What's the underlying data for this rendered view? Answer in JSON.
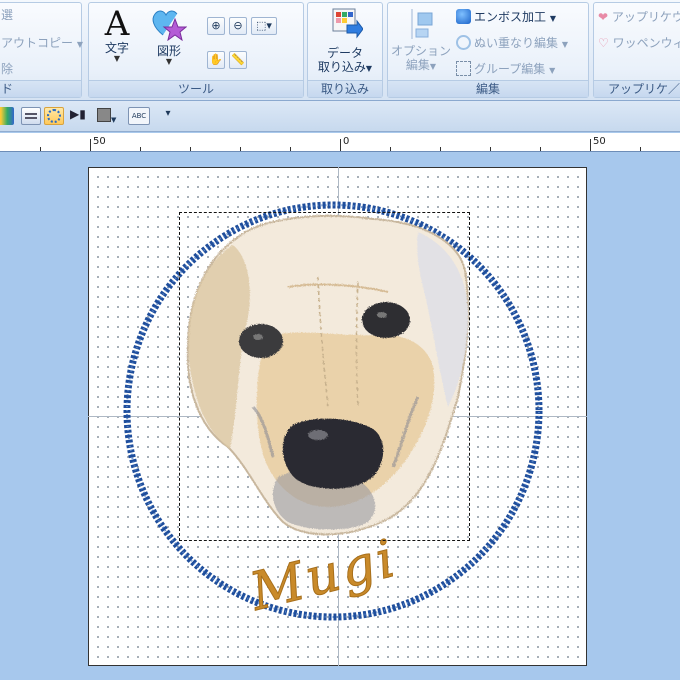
{
  "ribbon": {
    "group1": {
      "item1": "選",
      "item2": "アウトコピー",
      "item3": "除",
      "label": "ド"
    },
    "tools": {
      "text_label": "文字",
      "shape_label": "図形",
      "label": "ツール"
    },
    "import": {
      "data_label_line1": "データ",
      "data_label_line2": "取り込み",
      "label": "取り込み"
    },
    "edit": {
      "option_line1": "オプション",
      "option_line2": "編集",
      "emboss": "エンボス加工",
      "overlap": "ぬい重なり編集",
      "group_edit": "グループ編集",
      "label": "編集"
    },
    "applique": {
      "item1": "アップリケウ",
      "item2": "ワッペンウィ",
      "label": "アップリケ／ワ"
    }
  },
  "toolbar2": {
    "abc": "ABC"
  },
  "ruler": {
    "marks": [
      "50",
      "0",
      "50"
    ]
  },
  "design": {
    "name_text": "Mugi"
  },
  "colors": {
    "ring": "#1f4e9c",
    "text": "#c98a2a",
    "grid_dot": "#9aa3ad"
  }
}
